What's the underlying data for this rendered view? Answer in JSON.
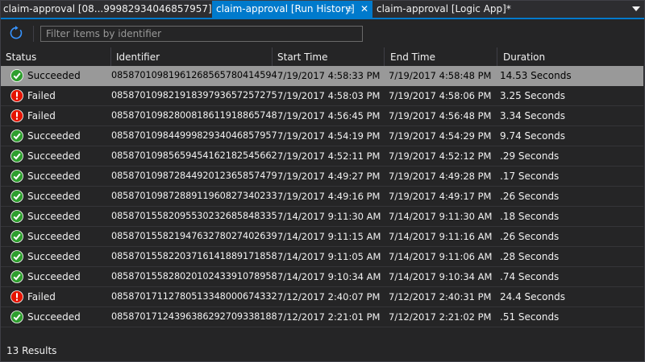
{
  "tabs": [
    {
      "label": "claim-approval [08...99982934046857957]",
      "active": false
    },
    {
      "label": "claim-approval [Run History]",
      "active": true
    },
    {
      "label": "claim-approval [Logic App]*",
      "active": false
    }
  ],
  "tab_icons": {
    "pin": "pin-icon",
    "close": "close-icon",
    "overflow": "chevron-down-icon"
  },
  "toolbar": {
    "refresh_icon": "refresh-icon",
    "filter_placeholder": "Filter items by identifier",
    "filter_value": ""
  },
  "columns": {
    "status": "Status",
    "identifier": "Identifier",
    "start_time": "Start Time",
    "end_time": "End Time",
    "duration": "Duration"
  },
  "colors": {
    "accent": "#007acc",
    "success": "#2e9e2e",
    "failed": "#e51400",
    "selected_row": "#999999"
  },
  "rows": [
    {
      "status": "Succeeded",
      "identifier": "08587010981961268565780414594",
      "start": "7/19/2017 4:58:33 PM",
      "end": "7/19/2017 4:58:48 PM",
      "duration": "14.53 Seconds",
      "selected": true
    },
    {
      "status": "Failed",
      "identifier": "08587010982191839793657257275",
      "start": "7/19/2017 4:58:03 PM",
      "end": "7/19/2017 4:58:06 PM",
      "duration": "3.25 Seconds"
    },
    {
      "status": "Failed",
      "identifier": "08587010982800818611918865748",
      "start": "7/19/2017 4:56:45 PM",
      "end": "7/19/2017 4:56:48 PM",
      "duration": "3.34 Seconds"
    },
    {
      "status": "Succeeded",
      "identifier": "08587010984499982934046857957",
      "start": "7/19/2017 4:54:19 PM",
      "end": "7/19/2017 4:54:29 PM",
      "duration": "9.74 Seconds"
    },
    {
      "status": "Succeeded",
      "identifier": "08587010985659454162182545662",
      "start": "7/19/2017 4:52:11 PM",
      "end": "7/19/2017 4:52:12 PM",
      "duration": ".29 Seconds"
    },
    {
      "status": "Succeeded",
      "identifier": "08587010987284492012365857479",
      "start": "7/19/2017 4:49:27 PM",
      "end": "7/19/2017 4:49:28 PM",
      "duration": ".17 Seconds"
    },
    {
      "status": "Succeeded",
      "identifier": "08587010987288911960827340233",
      "start": "7/19/2017 4:49:16 PM",
      "end": "7/19/2017 4:49:17 PM",
      "duration": ".26 Seconds"
    },
    {
      "status": "Succeeded",
      "identifier": "08587015582095530232685848335",
      "start": "7/14/2017 9:11:30 AM",
      "end": "7/14/2017 9:11:30 AM",
      "duration": ".18 Seconds"
    },
    {
      "status": "Succeeded",
      "identifier": "08587015582194763278027402639",
      "start": "7/14/2017 9:11:15 AM",
      "end": "7/14/2017 9:11:16 AM",
      "duration": ".26 Seconds"
    },
    {
      "status": "Succeeded",
      "identifier": "08587015582203716141889171858",
      "start": "7/14/2017 9:11:05 AM",
      "end": "7/14/2017 9:11:06 AM",
      "duration": ".28 Seconds"
    },
    {
      "status": "Succeeded",
      "identifier": "08587015582802010243391078958",
      "start": "7/14/2017 9:10:34 AM",
      "end": "7/14/2017 9:10:34 AM",
      "duration": ".74 Seconds"
    },
    {
      "status": "Failed",
      "identifier": "08587017112780513348000674332",
      "start": "7/12/2017 2:40:07 PM",
      "end": "7/12/2017 2:40:31 PM",
      "duration": "24.4 Seconds"
    },
    {
      "status": "Succeeded",
      "identifier": "08587017124396386292709338188",
      "start": "7/12/2017 2:21:01 PM",
      "end": "7/12/2017 2:21:02 PM",
      "duration": ".51 Seconds"
    }
  ],
  "footer": {
    "results": "13 Results"
  }
}
